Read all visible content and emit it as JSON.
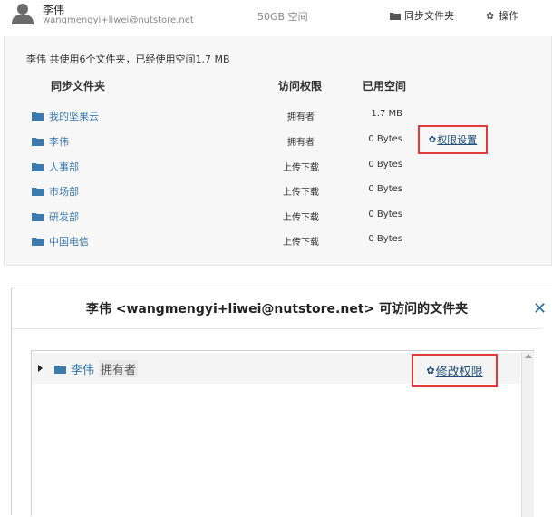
{
  "user": {
    "name": "李伟",
    "email": "wangmengyi+liwei@nutstore.net"
  },
  "header": {
    "quota": "50GB 空间",
    "sync_folders_label": "同步文件夹",
    "actions_label": "操作"
  },
  "summary": "李伟 共使用6个文件夹，已经使用空间1.7 MB",
  "table": {
    "headers": [
      "同步文件夹",
      "访问权限",
      "已用空间"
    ],
    "rows": [
      {
        "name": "我的坚果云",
        "perm": "拥有者",
        "used": "1.7 MB"
      },
      {
        "name": "李伟",
        "perm": "拥有者",
        "used": "0 Bytes"
      },
      {
        "name": "人事部",
        "perm": "上传下载",
        "used": "0 Bytes"
      },
      {
        "name": "市场部",
        "perm": "上传下载",
        "used": "0 Bytes"
      },
      {
        "name": "研发部",
        "perm": "上传下载",
        "used": "0 Bytes"
      },
      {
        "name": "中国电信",
        "perm": "上传下载",
        "used": "0 Bytes"
      }
    ],
    "perm_setting_label": "权限设置"
  },
  "dialog": {
    "title": "李伟 <wangmengyi+liwei@nutstore.net> 可访问的文件夹",
    "close_glyph": "✕",
    "tree_item": {
      "name": "李伟",
      "role": "拥有者"
    },
    "modify_label": "修改权限"
  },
  "colors": {
    "link": "#3b7bb0",
    "highlight_box": "#e03a3a"
  },
  "icons": [
    "user-avatar-icon",
    "folder-icon",
    "gear-icon",
    "close-icon",
    "expand-arrow-icon"
  ]
}
